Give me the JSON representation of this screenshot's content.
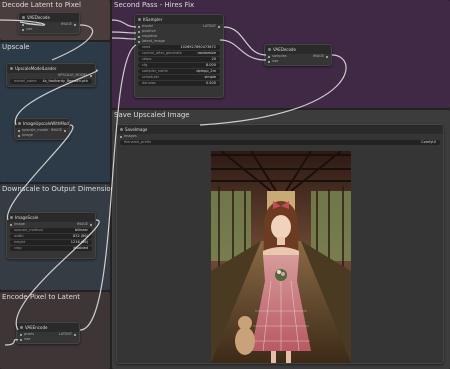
{
  "colors": {
    "group_decode": "#4a3d3d",
    "group_upscale": "#2c3b47",
    "group_downscale": "#363c44",
    "group_encode": "#3d3536",
    "group_second_pass": "#3f2945",
    "group_save": "#3c3c3c"
  },
  "groups": {
    "decode": "Decode Latent to Pixel",
    "upscale": "Upscale",
    "downscale": "Downscale to Output Dimensions",
    "encode": "Encode Pixel to Latent",
    "second_pass": "Second Pass - Hires Fix",
    "save": "Save Upscaled Image"
  },
  "nodes": {
    "vae_decode_1": {
      "title": "VAEDecode",
      "in_samples": "samples",
      "in_vae": "vae",
      "out_image": "IMAGE"
    },
    "upscale_loader": {
      "title": "UpscaleModelLoader",
      "out": "UPSCALE_MODEL",
      "widget_label": "model_name",
      "widget_value": "4x_foolhardy_Remacri.pth"
    },
    "upscale_with_model": {
      "title": "ImageUpscaleWithModel",
      "in_model": "upscale_model",
      "in_image": "image",
      "out": "IMAGE"
    },
    "image_scale": {
      "title": "ImageScale",
      "in_image": "image",
      "out": "IMAGE",
      "widgets": [
        {
          "label": "upscale_method",
          "value": "bilinear"
        },
        {
          "label": "width",
          "value": "832 (86)"
        },
        {
          "label": "height",
          "value": "1216 (86)"
        },
        {
          "label": "crop",
          "value": "disabled"
        }
      ]
    },
    "vae_encode": {
      "title": "VAEEncode",
      "in_pixels": "pixels",
      "in_vae": "vae",
      "out": "LATENT"
    },
    "ksampler": {
      "title": "KSampler",
      "inputs": [
        "model",
        "positive",
        "negative",
        "latent_image"
      ],
      "out": "LATENT",
      "widgets": [
        {
          "label": "seed",
          "value": "1026927890473672"
        },
        {
          "label": "control_after_generate",
          "value": "randomize"
        },
        {
          "label": "steps",
          "value": "20"
        },
        {
          "label": "cfg",
          "value": "8.000"
        },
        {
          "label": "sampler_name",
          "value": "dpmpp_2m"
        },
        {
          "label": "scheduler",
          "value": "simple"
        },
        {
          "label": "denoise",
          "value": "0.500"
        }
      ]
    },
    "vae_decode_2": {
      "title": "VAEDecode",
      "in_samples": "samples",
      "in_vae": "vae",
      "out": "IMAGE"
    },
    "save_image": {
      "title": "SaveImage",
      "in_images": "images",
      "widget_label": "filename_prefix",
      "widget_value": "ComfyUI"
    }
  }
}
